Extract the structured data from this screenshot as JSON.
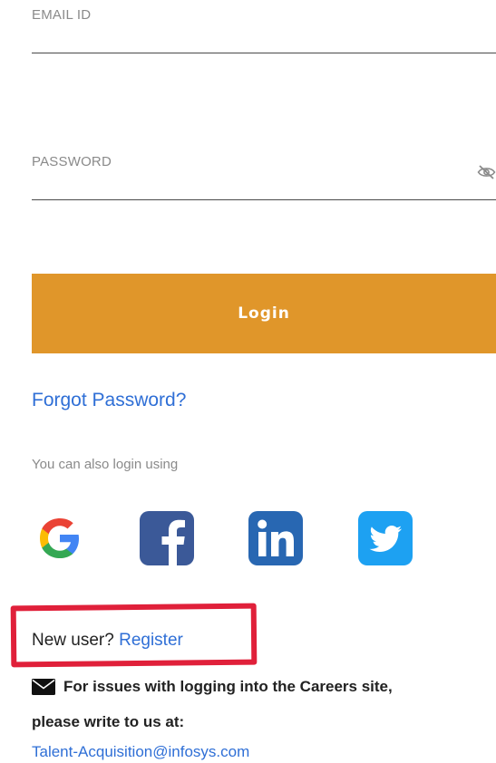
{
  "login_form": {
    "email_label": "EMAIL ID",
    "email_value": "",
    "password_label": "PASSWORD",
    "password_value": "",
    "password_toggle_icon": "eye-off-icon",
    "login_button_label": "Login",
    "forgot_password_label": "Forgot Password?"
  },
  "social_login": {
    "heading": "You can also login using",
    "providers": [
      {
        "name": "google",
        "icon": "google-icon"
      },
      {
        "name": "facebook",
        "icon": "facebook-icon",
        "color": "#3b5998"
      },
      {
        "name": "linkedin",
        "icon": "linkedin-icon",
        "color": "#2867b2"
      },
      {
        "name": "twitter",
        "icon": "twitter-icon",
        "color": "#1da1f2"
      }
    ]
  },
  "registration": {
    "prompt": "New user? ",
    "register_label": "Register",
    "highlight_color": "#e0203a"
  },
  "support": {
    "icon": "envelope-icon",
    "line1": "For issues with logging into the Careers site,",
    "line2": "please write to us at:",
    "email": "Talent-Acquisition@infosys.com"
  },
  "colors": {
    "accent": "#e0962a",
    "link": "#2f6fd6"
  }
}
